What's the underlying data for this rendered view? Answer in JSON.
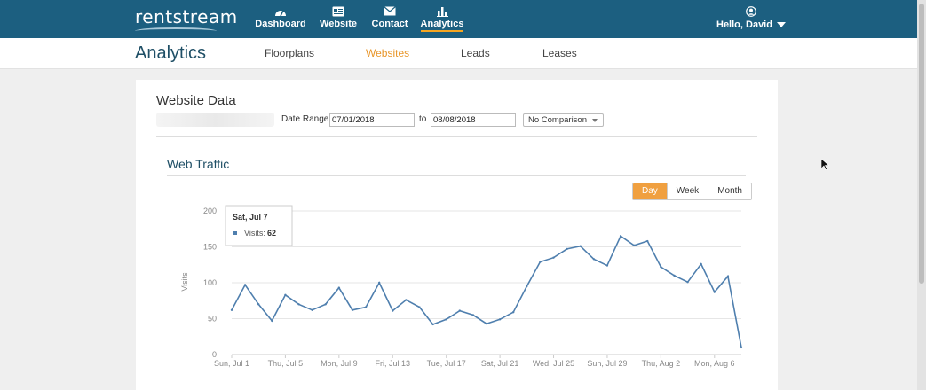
{
  "app": {
    "logo": "rentstream",
    "nav": [
      {
        "label": "Dashboard",
        "icon": "gauge-icon",
        "active": false
      },
      {
        "label": "Website",
        "icon": "website-icon",
        "active": false
      },
      {
        "label": "Contact",
        "icon": "envelope-icon",
        "active": false
      },
      {
        "label": "Analytics",
        "icon": "bar-chart-icon",
        "active": true
      }
    ],
    "user": {
      "label": "Hello, David",
      "icon": "user-icon"
    }
  },
  "subnav": {
    "title": "Analytics",
    "tabs": [
      {
        "label": "Floorplans",
        "active": false
      },
      {
        "label": "Websites",
        "active": true
      },
      {
        "label": "Leads",
        "active": false
      },
      {
        "label": "Leases",
        "active": false
      }
    ]
  },
  "filters": {
    "title": "Website Data",
    "date_range_label": "Date Range",
    "start_date": "07/01/2018",
    "to_label": "to",
    "end_date": "08/08/2018",
    "comparison": "No Comparison"
  },
  "traffic": {
    "title": "Web Traffic",
    "granularity": [
      {
        "label": "Day",
        "active": true
      },
      {
        "label": "Week",
        "active": false
      },
      {
        "label": "Month",
        "active": false
      }
    ]
  },
  "chart_data": {
    "type": "line",
    "ylabel": "Visits",
    "ylim": [
      0,
      200
    ],
    "yticks": [
      0,
      50,
      100,
      150,
      200
    ],
    "xtick_labels": [
      "Sun, Jul 1",
      "Thu, Jul 5",
      "Mon, Jul 9",
      "Fri, Jul 13",
      "Tue, Jul 17",
      "Sat, Jul 21",
      "Wed, Jul 25",
      "Sun, Jul 29",
      "Thu, Aug 2",
      "Mon, Aug 6"
    ],
    "x": [
      "2018-07-01",
      "2018-07-02",
      "2018-07-03",
      "2018-07-04",
      "2018-07-05",
      "2018-07-06",
      "2018-07-07",
      "2018-07-08",
      "2018-07-09",
      "2018-07-10",
      "2018-07-11",
      "2018-07-12",
      "2018-07-13",
      "2018-07-14",
      "2018-07-15",
      "2018-07-16",
      "2018-07-17",
      "2018-07-18",
      "2018-07-19",
      "2018-07-20",
      "2018-07-21",
      "2018-07-22",
      "2018-07-23",
      "2018-07-24",
      "2018-07-25",
      "2018-07-26",
      "2018-07-27",
      "2018-07-28",
      "2018-07-29",
      "2018-07-30",
      "2018-07-31",
      "2018-08-01",
      "2018-08-02",
      "2018-08-03",
      "2018-08-04",
      "2018-08-05",
      "2018-08-06",
      "2018-08-07",
      "2018-08-08"
    ],
    "series": [
      {
        "name": "Visits",
        "color": "#4f7fae",
        "values": [
          62,
          97,
          70,
          47,
          83,
          70,
          62,
          70,
          93,
          62,
          66,
          100,
          61,
          76,
          66,
          42,
          49,
          61,
          55,
          43,
          49,
          59,
          95,
          129,
          135,
          147,
          151,
          133,
          124,
          165,
          152,
          158,
          122,
          110,
          101,
          126,
          87,
          109,
          10
        ]
      }
    ],
    "tooltip": {
      "title": "Sat, Jul 7",
      "series_label": "Visits:",
      "value": "62"
    },
    "grid": true,
    "legend": "none"
  }
}
